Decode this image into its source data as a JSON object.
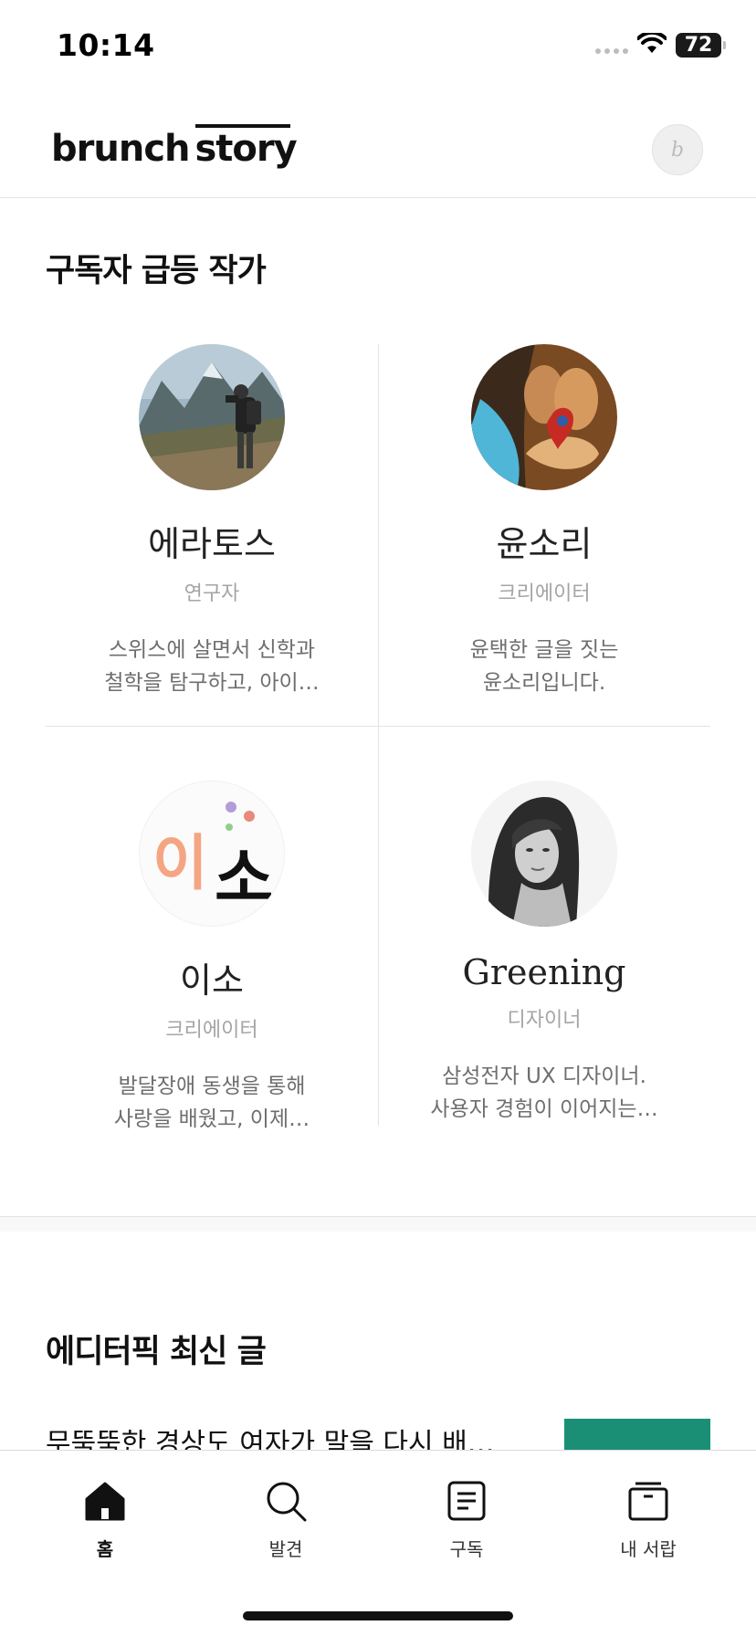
{
  "status_bar": {
    "time": "10:14",
    "battery": "72"
  },
  "header": {
    "logo_part1": "brunch",
    "logo_part2": "story",
    "write_icon": "pen-icon"
  },
  "section_rising_authors": {
    "title": "구독자 급등 작가",
    "authors": [
      {
        "name": "에라토스",
        "role": "연구자",
        "desc_line1": "스위스에 살면서 신학과",
        "desc_line2": "철학을 탐구하고, 아이…"
      },
      {
        "name": "윤소리",
        "role": "크리에이터",
        "desc_line1": "윤택한 글을 짓는",
        "desc_line2": "윤소리입니다."
      },
      {
        "name": "이소",
        "role": "크리에이터",
        "desc_line1": "발달장애 동생을 통해",
        "desc_line2": "사랑을 배웠고, 이제…",
        "avatar_text_1": "이",
        "avatar_text_2": "소"
      },
      {
        "name": "Greening",
        "role": "디자이너",
        "desc_line1": "삼성전자 UX 디자이너.",
        "desc_line2": "사용자 경험이 이어지는…"
      }
    ]
  },
  "section_editor_pick": {
    "title": "에디터픽 최신 글",
    "article_title": "무뚝뚝한 경상도 여자가 말을 다시 배…"
  },
  "tab_bar": {
    "tabs": [
      {
        "label": "홈",
        "icon": "home-icon",
        "active": true
      },
      {
        "label": "발견",
        "icon": "search-icon",
        "active": false
      },
      {
        "label": "구독",
        "icon": "document-icon",
        "active": false
      },
      {
        "label": "내 서랍",
        "icon": "drawer-icon",
        "active": false
      }
    ]
  },
  "colors": {
    "accent_thumb": "#1a8f76",
    "divider": "#e3e3e3",
    "muted_text": "#a5a5a5"
  }
}
